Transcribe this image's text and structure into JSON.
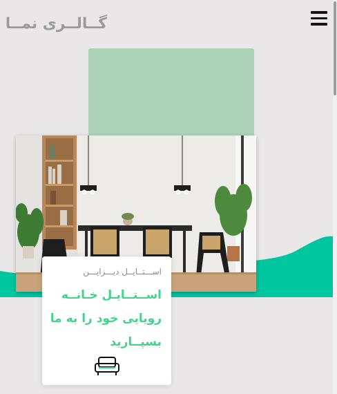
{
  "header": {
    "logo_text": "گــالــری نمــا",
    "menu_icon": "hamburger-menu-icon"
  },
  "hero": {
    "image_description_icon": "dining-room-photo",
    "accent_colors": {
      "green_block": "#abd2b6",
      "wave": "#00c6a0",
      "title_green": "#3ed58a"
    }
  },
  "card": {
    "kicker": "اســـتــایــل دیـــزایـــن",
    "title_lines": [
      "اســتــایـل خـانــه",
      "رویایی خود را به ما",
      "بسپــارید"
    ],
    "icon": "sofa-icon"
  }
}
